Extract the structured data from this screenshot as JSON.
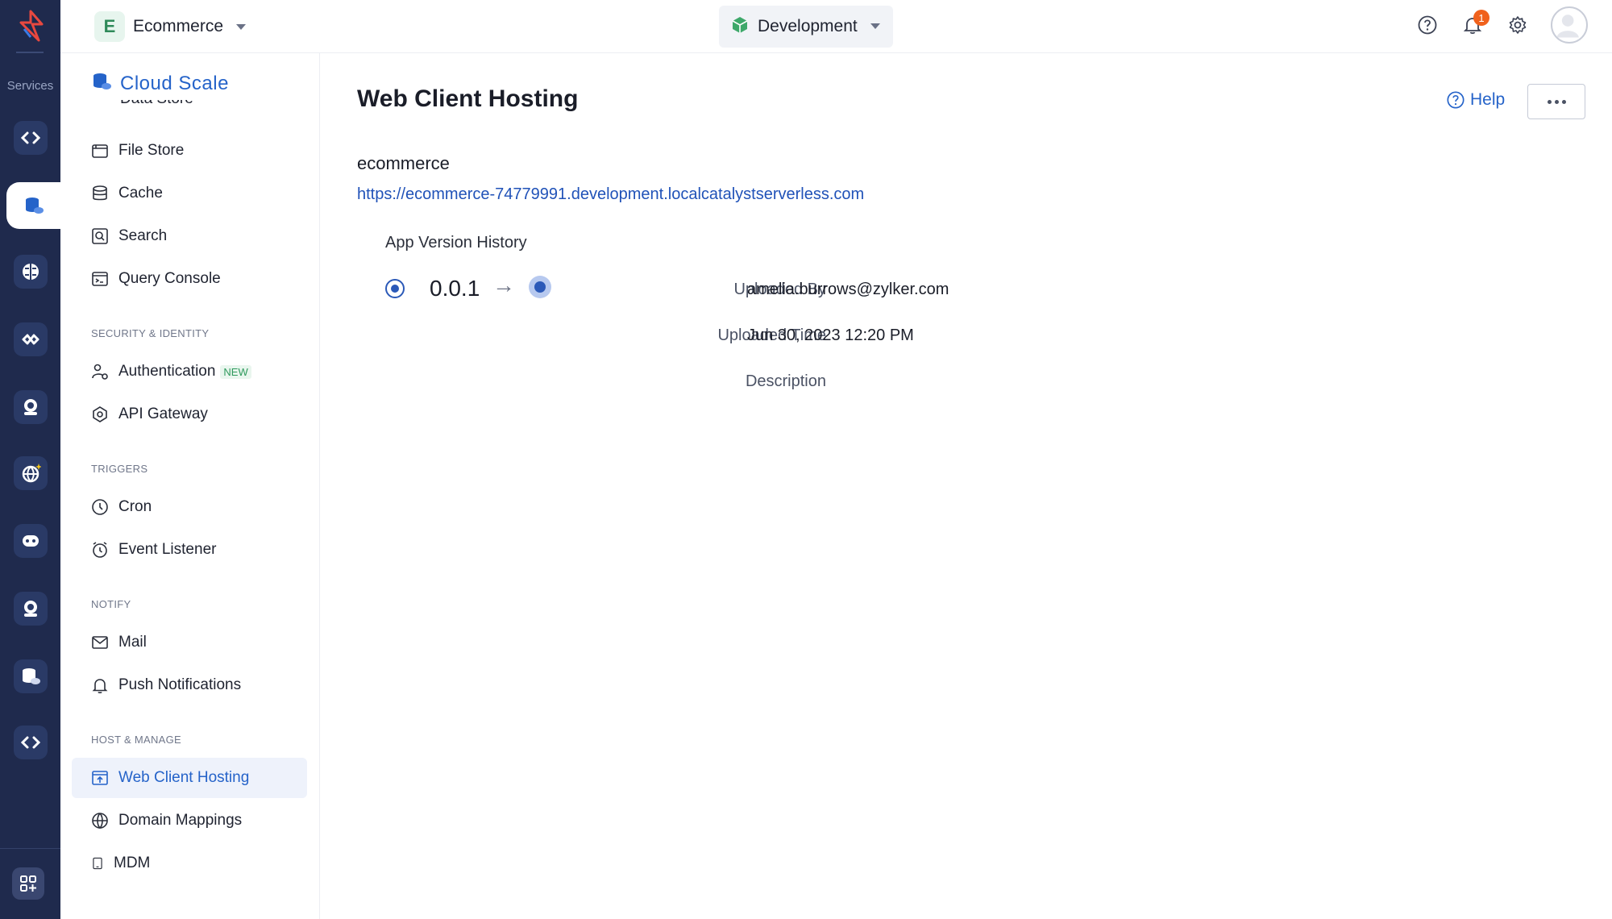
{
  "rail": {
    "services_label": "Services"
  },
  "topbar": {
    "project_initial": "E",
    "project_name": "Ecommerce",
    "environment": "Development",
    "notification_count": "1"
  },
  "sidebar": {
    "title": "Cloud Scale",
    "clipped_item": "Data Store",
    "items": {
      "file_store": "File Store",
      "cache": "Cache",
      "search": "Search",
      "query_console": "Query Console",
      "authentication": "Authentication",
      "authentication_tag": "NEW",
      "api_gateway": "API Gateway",
      "cron": "Cron",
      "event_listener": "Event Listener",
      "mail": "Mail",
      "push_notifications": "Push Notifications",
      "web_client_hosting": "Web Client Hosting",
      "domain_mappings": "Domain Mappings",
      "mdm": "MDM"
    },
    "sections": {
      "security": "SECURITY & IDENTITY",
      "triggers": "TRIGGERS",
      "notify": "NOTIFY",
      "host": "HOST & MANAGE"
    }
  },
  "main": {
    "title": "Web Client Hosting",
    "help_label": "Help",
    "app_name": "ecommerce",
    "app_url": "https://ecommerce-74779991.development.localcatalystserverless.com",
    "history_title": "App Version History",
    "version": "0.0.1",
    "arrow": "→",
    "uploaded_by_label": "Uploaded By",
    "uploaded_by_value": "amelia.burrows@zylker.com",
    "uploaded_time_label": "Uploaded Time",
    "uploaded_time_value": "Jun 30, 2023 12:20 PM",
    "description_label": "Description",
    "description_value": ""
  },
  "colors": {
    "rail_bg": "#1f2a4d",
    "accent": "#2563c9",
    "link": "#2052b8",
    "notification": "#f0611c"
  }
}
